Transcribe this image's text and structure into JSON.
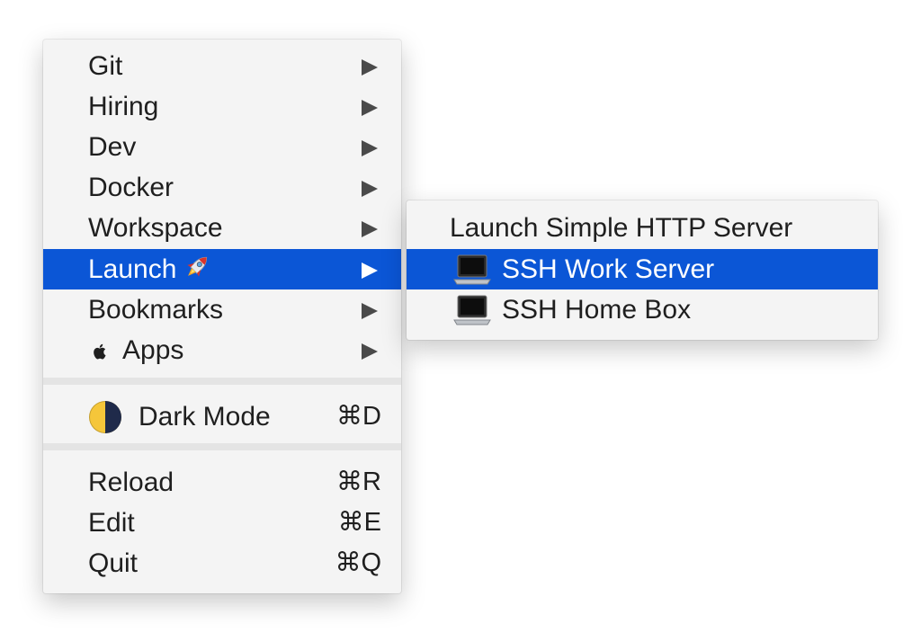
{
  "main_menu": {
    "items": [
      {
        "label": "Git"
      },
      {
        "label": "Hiring"
      },
      {
        "label": "Dev"
      },
      {
        "label": "Docker"
      },
      {
        "label": "Workspace"
      },
      {
        "label": "Launch",
        "selected": true
      },
      {
        "label": "Bookmarks"
      },
      {
        "label": "Apps"
      }
    ],
    "dark_mode": {
      "label": "Dark Mode",
      "shortcut": "⌘D"
    },
    "actions": [
      {
        "label": "Reload",
        "shortcut": "⌘R"
      },
      {
        "label": "Edit",
        "shortcut": "⌘E"
      },
      {
        "label": "Quit",
        "shortcut": "⌘Q"
      }
    ]
  },
  "launch_submenu": {
    "items": [
      {
        "label": "Launch Simple HTTP Server"
      },
      {
        "label": "SSH Work Server",
        "selected": true,
        "icon": "laptop-icon"
      },
      {
        "label": "SSH Home Box",
        "icon": "laptop-icon"
      }
    ]
  },
  "colors": {
    "selection": "#0b56d6",
    "menu_background": "#f4f4f4",
    "text": "#1f1f1f"
  },
  "icons": {
    "launch": "rocket-icon",
    "apps": "apple-icon",
    "dark_mode": "moon-icon",
    "submenu": "chevron-right-icon"
  }
}
